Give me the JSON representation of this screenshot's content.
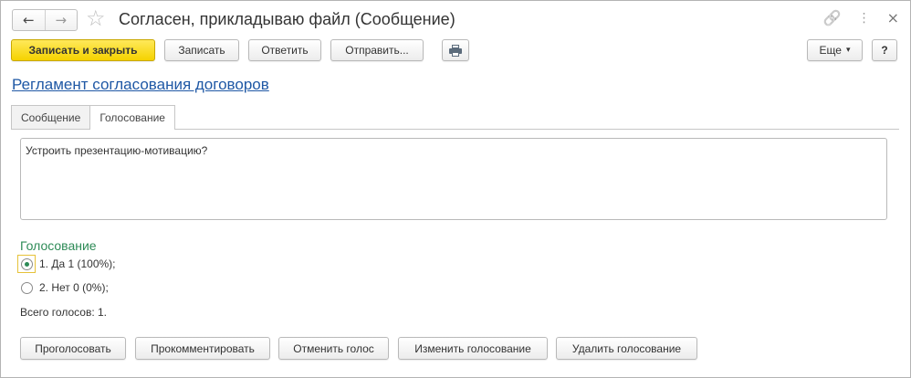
{
  "window": {
    "title": "Согласен, прикладываю файл (Сообщение)"
  },
  "titlebar": {
    "back_icon": "←",
    "forward_icon": "→",
    "favorite_icon": "☆",
    "link_icon": "🔗",
    "more_icon": "⋮",
    "close_icon": "×"
  },
  "toolbar": {
    "save_and_close_label": "Записать и закрыть",
    "save_label": "Записать",
    "reply_label": "Ответить",
    "send_label": "Отправить...",
    "more_label": "Еще",
    "more_caret": "▾",
    "help_label": "?"
  },
  "header": {
    "link_title": "Регламент согласования договоров"
  },
  "tabs": [
    {
      "label": "Сообщение",
      "active": false
    },
    {
      "label": "Голосование",
      "active": true
    }
  ],
  "message": {
    "text": "Устроить презентацию-мотивацию?"
  },
  "voting": {
    "title": "Голосование",
    "options": [
      {
        "label": "1. Да 1 (100%);",
        "checked": true
      },
      {
        "label": "2. Нет 0 (0%);",
        "checked": false
      }
    ],
    "total": "Всего голосов: 1."
  },
  "actions": {
    "vote_label": "Проголосовать",
    "comment_label": "Прокомментировать",
    "cancel_vote_label": "Отменить голос",
    "edit_voting_label": "Изменить голосование",
    "delete_voting_label": "Удалить голосование"
  },
  "colors": {
    "accent_primary": "#f5d200",
    "link": "#1f58a5",
    "voting_title": "#2e8b57"
  }
}
